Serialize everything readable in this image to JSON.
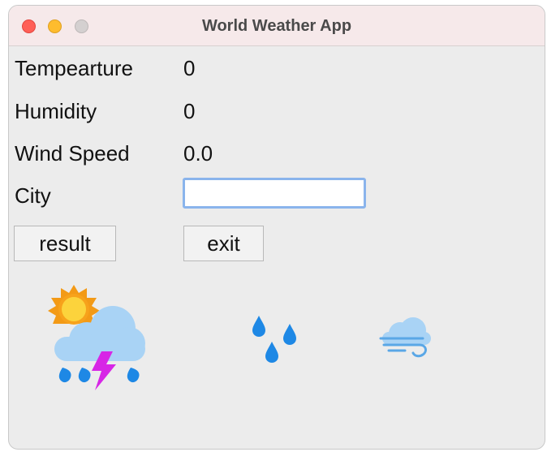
{
  "window": {
    "title": "World Weather App"
  },
  "fields": {
    "temperature_label": "Tempearture",
    "temperature_value": "0",
    "humidity_label": "Humidity",
    "humidity_value": "0",
    "wind_speed_label": "Wind Speed",
    "wind_speed_value": "0.0",
    "city_label": "City",
    "city_value": ""
  },
  "buttons": {
    "result_label": "result",
    "exit_label": "exit"
  },
  "icons": {
    "weather": "sun-thunderstorm-icon",
    "humidity": "rain-drops-icon",
    "wind": "wind-cloud-icon"
  },
  "colors": {
    "sun": "#f7a21b",
    "cloud": "#a9d3f5",
    "lightning": "#d726e6",
    "drop": "#1e88e5",
    "input_focus": "#8ab4ec"
  }
}
